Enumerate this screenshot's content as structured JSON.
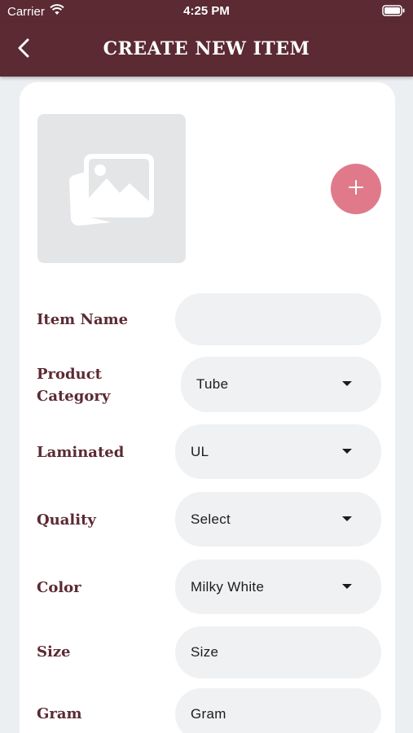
{
  "status_bar": {
    "carrier": "Carrier",
    "time": "4:25 PM"
  },
  "header": {
    "title": "CREATE NEW ITEM"
  },
  "icons": {
    "back": "chevron-left-icon",
    "photo": "image-placeholder-icon",
    "add": "plus-icon",
    "dropdown": "caret-down-icon"
  },
  "colors": {
    "header_bg": "#5b2a33",
    "label": "#5b2a33",
    "add_button": "#e07a8a",
    "field_bg": "#eff1f3"
  },
  "form": {
    "item_name": {
      "label": "Item Name",
      "value": ""
    },
    "product_category": {
      "label_line1": "Product",
      "label_line2": "Category",
      "value": "Tube"
    },
    "laminated": {
      "label": "Laminated",
      "value": "UL"
    },
    "quality": {
      "label": "Quality",
      "value": "Select"
    },
    "color": {
      "label": "Color",
      "value": "Milky White"
    },
    "size": {
      "label": "Size",
      "placeholder": "Size"
    },
    "gram": {
      "label": "Gram",
      "placeholder": "Gram"
    }
  }
}
